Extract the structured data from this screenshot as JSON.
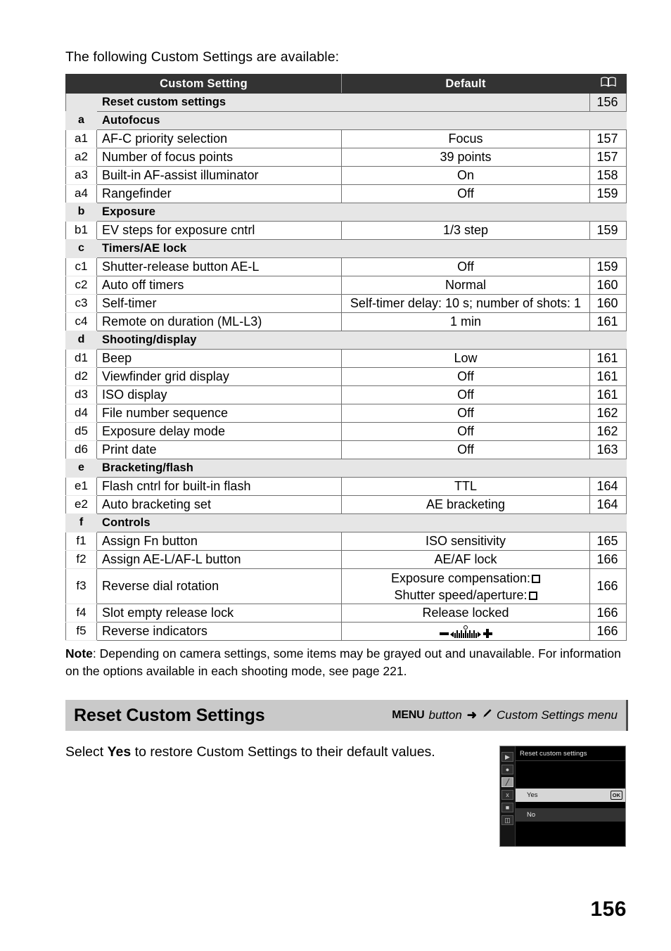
{
  "intro": "The following Custom Settings are available:",
  "table": {
    "headers": {
      "setting": "Custom Setting",
      "default": "Default",
      "page_icon": "book-icon"
    },
    "rows": [
      {
        "kind": "reset",
        "idx": "",
        "name": "Reset custom settings",
        "default": "",
        "page": "156"
      },
      {
        "kind": "group",
        "idx": "a",
        "name": "Autofocus",
        "default": "",
        "page": ""
      },
      {
        "kind": "item",
        "idx": "a1",
        "name": "AF-C priority selection",
        "default": "Focus",
        "page": "157"
      },
      {
        "kind": "item",
        "idx": "a2",
        "name": "Number of focus points",
        "default": "39 points",
        "page": "157"
      },
      {
        "kind": "item",
        "idx": "a3",
        "name": "Built-in AF-assist illuminator",
        "default": "On",
        "page": "158"
      },
      {
        "kind": "item",
        "idx": "a4",
        "name": "Rangefinder",
        "default": "Off",
        "page": "159"
      },
      {
        "kind": "group",
        "idx": "b",
        "name": "Exposure",
        "default": "",
        "page": ""
      },
      {
        "kind": "item",
        "idx": "b1",
        "name": "EV steps for exposure cntrl",
        "default": "1/3 step",
        "page": "159"
      },
      {
        "kind": "group",
        "idx": "c",
        "name": "Timers/AE lock",
        "default": "",
        "page": ""
      },
      {
        "kind": "item",
        "idx": "c1",
        "name": "Shutter-release button AE-L",
        "default": "Off",
        "page": "159"
      },
      {
        "kind": "item",
        "idx": "c2",
        "name": "Auto off timers",
        "default": "Normal",
        "page": "160"
      },
      {
        "kind": "item",
        "idx": "c3",
        "name": "Self-timer",
        "default": "Self-timer delay: 10 s; number of shots: 1",
        "page": "160"
      },
      {
        "kind": "item",
        "idx": "c4",
        "name": "Remote on duration (ML-L3)",
        "default": "1 min",
        "page": "161"
      },
      {
        "kind": "group",
        "idx": "d",
        "name": "Shooting/display",
        "default": "",
        "page": ""
      },
      {
        "kind": "item",
        "idx": "d1",
        "name": "Beep",
        "default": "Low",
        "page": "161"
      },
      {
        "kind": "item",
        "idx": "d2",
        "name": "Viewfinder grid display",
        "default": "Off",
        "page": "161"
      },
      {
        "kind": "item",
        "idx": "d3",
        "name": "ISO display",
        "default": "Off",
        "page": "161"
      },
      {
        "kind": "item",
        "idx": "d4",
        "name": "File number sequence",
        "default": "Off",
        "page": "162"
      },
      {
        "kind": "item",
        "idx": "d5",
        "name": "Exposure delay mode",
        "default": "Off",
        "page": "162"
      },
      {
        "kind": "item",
        "idx": "d6",
        "name": "Print date",
        "default": "Off",
        "page": "163"
      },
      {
        "kind": "group",
        "idx": "e",
        "name": "Bracketing/flash",
        "default": "",
        "page": ""
      },
      {
        "kind": "item",
        "idx": "e1",
        "name": "Flash cntrl for built-in flash",
        "default": "TTL",
        "page": "164"
      },
      {
        "kind": "item",
        "idx": "e2",
        "name": "Auto bracketing set",
        "default": "AE bracketing",
        "page": "164"
      },
      {
        "kind": "group",
        "idx": "f",
        "name": "Controls",
        "default": "",
        "page": ""
      },
      {
        "kind": "item",
        "idx": "f1",
        "name": "Assign Fn button",
        "default": "ISO sensitivity",
        "page": "165"
      },
      {
        "kind": "item",
        "idx": "f2",
        "name": "Assign AE-L/AF-L button",
        "default": "AE/AF lock",
        "page": "166"
      },
      {
        "kind": "tall",
        "idx": "f3",
        "name": "Reverse dial rotation",
        "default_line1": "Exposure compensation:",
        "default_line2": "Shutter speed/aperture:",
        "page": "166"
      },
      {
        "kind": "item",
        "idx": "f4",
        "name": "Slot empty release lock",
        "default": "Release locked",
        "page": "166"
      },
      {
        "kind": "graphic",
        "idx": "f5",
        "name": "Reverse indicators",
        "default": "exposure-indicator-graphic",
        "page": "166"
      }
    ]
  },
  "note": {
    "label": "Note",
    "text": ": Depending on camera settings, some items may be grayed out and unavailable.  For information on the options available in each shooting mode, see page 221."
  },
  "section": {
    "title": "Reset Custom Settings",
    "menu_word": "MENU",
    "button_word": "button",
    "arrow": "➜",
    "pencil_icon": "pencil-icon",
    "menu_name": "Custom Settings menu"
  },
  "body": {
    "prefix": "Select ",
    "emphasis": "Yes",
    "suffix": " to restore Custom Settings to their default values."
  },
  "lcd": {
    "title": "Reset custom settings",
    "sidebar_icons": [
      "playback-icon",
      "shooting-menu-icon",
      "custom-settings-pencil-icon",
      "setup-wrench-icon",
      "retouch-icon",
      "recent-settings-icon"
    ],
    "options": [
      {
        "label": "Yes",
        "selected": true,
        "badge": "OK"
      },
      {
        "label": "No",
        "selected": false,
        "badge": ""
      }
    ]
  },
  "page_number": "156"
}
